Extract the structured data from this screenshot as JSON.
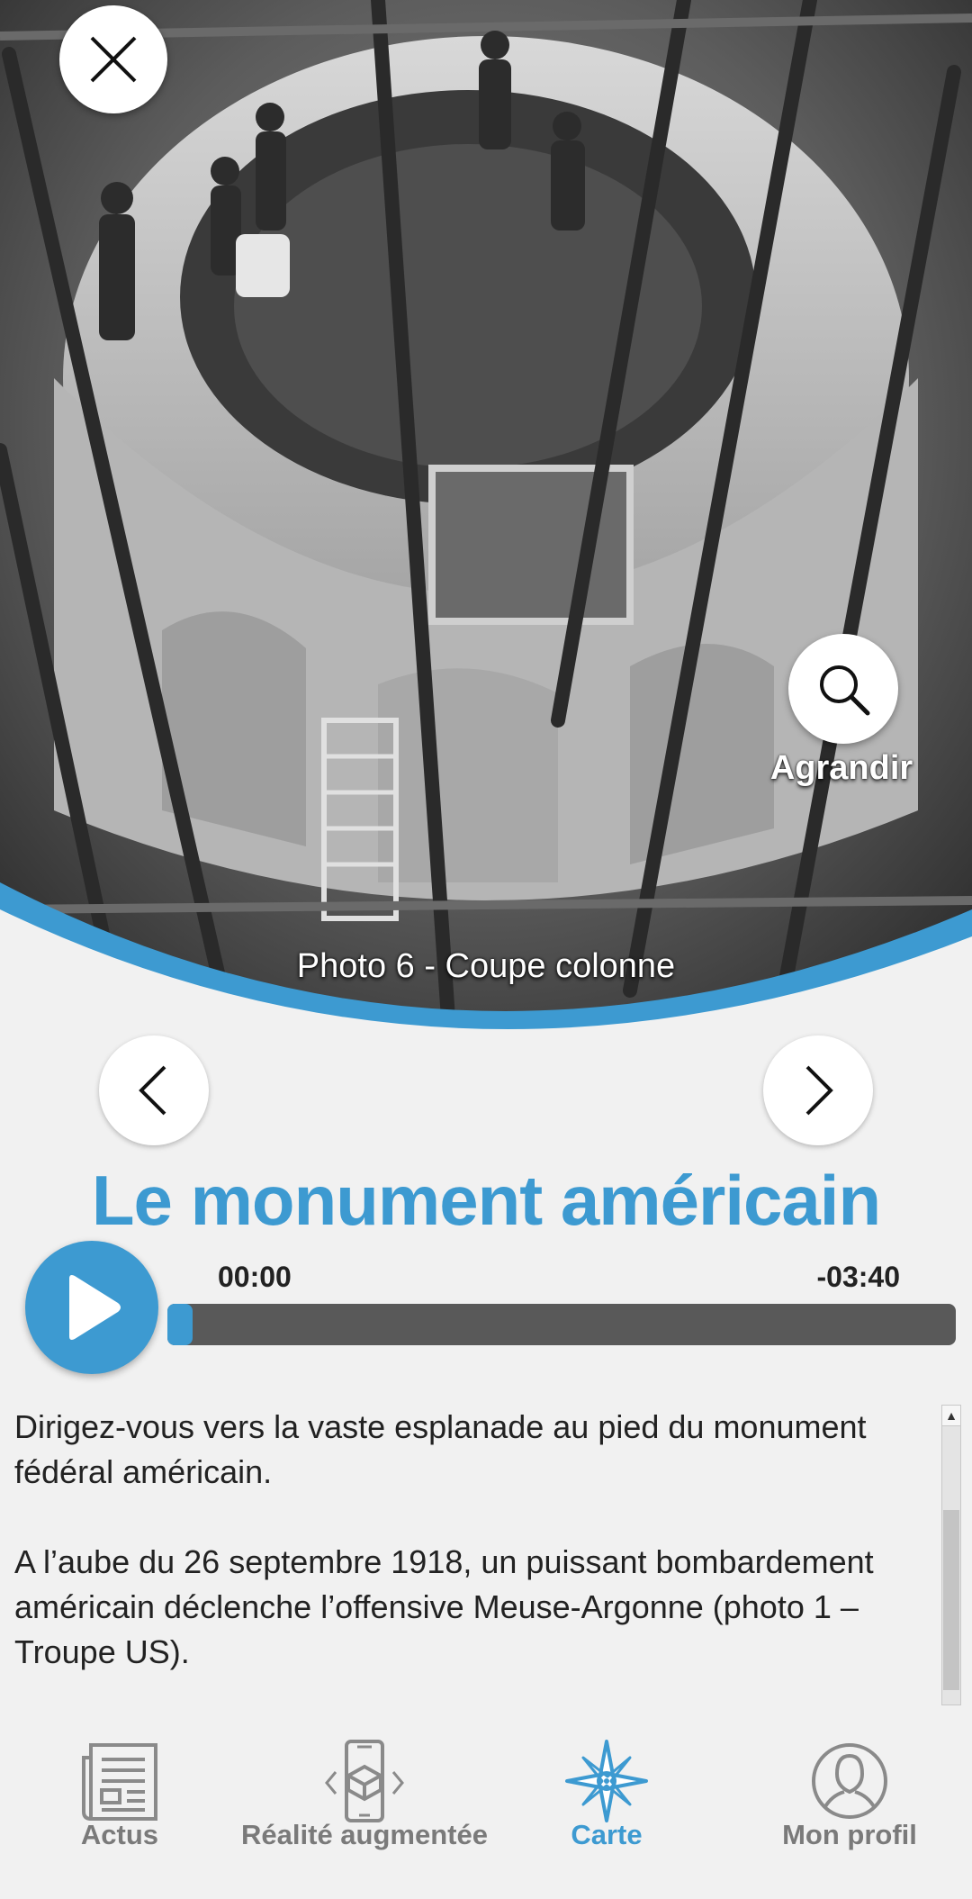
{
  "hero": {
    "caption": "Photo 6 - Coupe colonne",
    "zoom_label": "Agrandir",
    "icons": {
      "close": "close-icon",
      "zoom": "search-icon",
      "prev": "chevron-left-icon",
      "next": "chevron-right-icon"
    }
  },
  "title": "Le monument américain",
  "player": {
    "current_time": "00:00",
    "remaining_time": "-03:40",
    "progress": 0
  },
  "body_text": [
    "Dirigez-vous vers la vaste esplanade au pied du monument fédéral américain.",
    "A l’aube du 26 septembre 1918, un puissant bombardement américain déclenche l’offensive Meuse-Argonne (photo 1 – Troupe US)."
  ],
  "nav": {
    "items": [
      {
        "label": "Actus",
        "icon": "newspaper-icon"
      },
      {
        "label": "Réalité augmentée",
        "icon": "ar-phone-icon"
      },
      {
        "label": "Carte",
        "icon": "compass-rose-icon",
        "active": true
      },
      {
        "label": "Mon profil",
        "icon": "profile-icon"
      }
    ]
  },
  "colors": {
    "accent": "#3d9ad1",
    "background": "#f1f1f1",
    "track": "#595959"
  }
}
